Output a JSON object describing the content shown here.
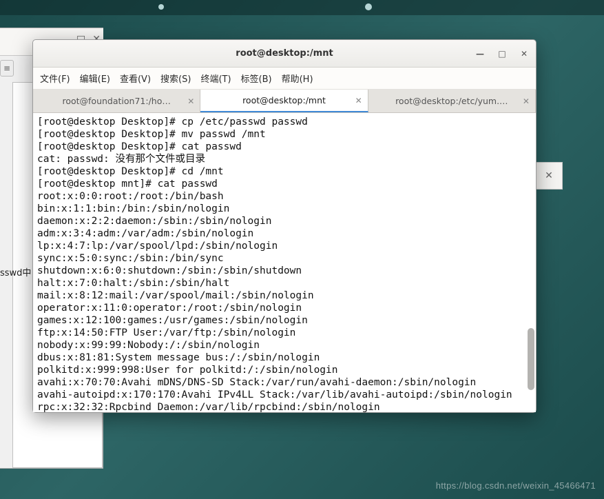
{
  "topbar": {},
  "bg_window": {
    "truncated_label": "sswd中"
  },
  "window": {
    "title": "root@desktop:/mnt",
    "controls": {
      "minimize": "—",
      "maximize": "□",
      "close": "✕"
    },
    "menu": {
      "file": "文件(F)",
      "edit": "编辑(E)",
      "view": "查看(V)",
      "search": "搜索(S)",
      "terminal": "终端(T)",
      "tabs": "标签(B)",
      "help": "帮助(H)"
    },
    "tabs": [
      {
        "label": "root@foundation71:/ho…",
        "active": false
      },
      {
        "label": "root@desktop:/mnt",
        "active": true
      },
      {
        "label": "root@desktop:/etc/yum.…",
        "active": false
      }
    ],
    "terminal_lines": [
      "[root@desktop Desktop]# cp /etc/passwd passwd",
      "[root@desktop Desktop]# mv passwd /mnt",
      "[root@desktop Desktop]# cat passwd",
      "cat: passwd: 没有那个文件或目录",
      "[root@desktop Desktop]# cd /mnt",
      "[root@desktop mnt]# cat passwd",
      "root:x:0:0:root:/root:/bin/bash",
      "bin:x:1:1:bin:/bin:/sbin/nologin",
      "daemon:x:2:2:daemon:/sbin:/sbin/nologin",
      "adm:x:3:4:adm:/var/adm:/sbin/nologin",
      "lp:x:4:7:lp:/var/spool/lpd:/sbin/nologin",
      "sync:x:5:0:sync:/sbin:/bin/sync",
      "shutdown:x:6:0:shutdown:/sbin:/sbin/shutdown",
      "halt:x:7:0:halt:/sbin:/sbin/halt",
      "mail:x:8:12:mail:/var/spool/mail:/sbin/nologin",
      "operator:x:11:0:operator:/root:/sbin/nologin",
      "games:x:12:100:games:/usr/games:/sbin/nologin",
      "ftp:x:14:50:FTP User:/var/ftp:/sbin/nologin",
      "nobody:x:99:99:Nobody:/:/sbin/nologin",
      "dbus:x:81:81:System message bus:/:/sbin/nologin",
      "polkitd:x:999:998:User for polkitd:/:/sbin/nologin",
      "avahi:x:70:70:Avahi mDNS/DNS-SD Stack:/var/run/avahi-daemon:/sbin/nologin",
      "avahi-autoipd:x:170:170:Avahi IPv4LL Stack:/var/lib/avahi-autoipd:/sbin/nologin",
      "rpc:x:32:32:Rpcbind Daemon:/var/lib/rpcbind:/sbin/nologin"
    ]
  },
  "watermark": "https://blog.csdn.net/weixin_45466471"
}
